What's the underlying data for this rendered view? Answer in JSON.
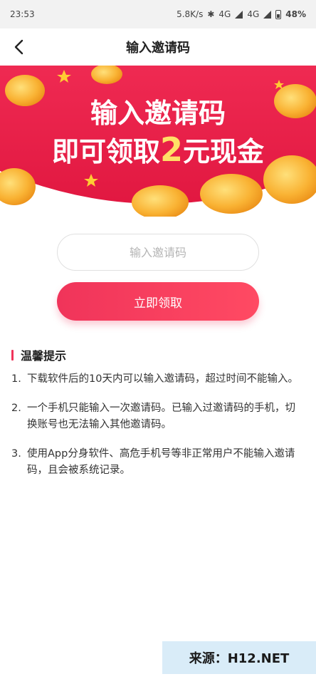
{
  "status_bar": {
    "time": "23:53",
    "speed": "5.8K/s",
    "net1": "4G",
    "net2": "4G",
    "battery": "48%"
  },
  "nav": {
    "title": "输入邀请码"
  },
  "banner": {
    "line1": "输入邀请码",
    "line2_prefix": "即可领取",
    "line2_amount": "2",
    "line2_suffix": "元现金"
  },
  "form": {
    "input_placeholder": "输入邀请码",
    "input_value": "",
    "submit_label": "立即领取"
  },
  "tips": {
    "title": "温馨提示",
    "items": [
      {
        "num": "1.",
        "text": "下载软件后的10天内可以输入邀请码，超过时间不能输入。"
      },
      {
        "num": "2.",
        "text": "一个手机只能输入一次邀请码。已输入过邀请码的手机，切换账号也无法输入其他邀请码。"
      },
      {
        "num": "3.",
        "text": "使用App分身软件、高危手机号等非正常用户不能输入邀请码，且会被系统记录。"
      }
    ]
  },
  "watermark": "来源：H12.NET",
  "colors": {
    "accent": "#f0345a",
    "banner_bg": "#e8244f",
    "coin": "#f9b233"
  }
}
